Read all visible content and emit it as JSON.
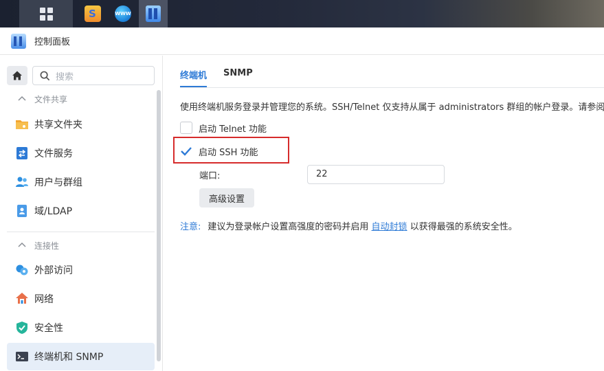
{
  "window": {
    "title": "控制面板"
  },
  "taskbar": {
    "apps": [
      {
        "name": "main-menu",
        "icon": "grid-icon"
      },
      {
        "name": "package-center",
        "icon": "package-icon"
      },
      {
        "name": "web-station",
        "icon": "www-icon",
        "badge": "WWW"
      },
      {
        "name": "control-panel",
        "icon": "control-panel-icon"
      }
    ]
  },
  "sidebar": {
    "search_placeholder": "搜索",
    "groups": [
      {
        "label": "文件共享",
        "items": [
          "共享文件夹",
          "文件服务",
          "用户与群组",
          "域/LDAP"
        ]
      },
      {
        "label": "连接性",
        "items": [
          "外部访问",
          "网络",
          "安全性",
          "终端机和 SNMP"
        ]
      }
    ],
    "active_item": "终端机和 SNMP"
  },
  "main": {
    "tabs": [
      {
        "label": "终端机",
        "active": true
      },
      {
        "label": "SNMP",
        "active": false
      }
    ],
    "description": "使用终端机服务登录并管理您的系统。SSH/Telnet 仅支持从属于 administrators 群组的帐户登录。请参阅",
    "telnet": {
      "label": "启动 Telnet 功能",
      "checked": false
    },
    "ssh": {
      "label": "启动 SSH 功能",
      "checked": true
    },
    "port": {
      "label": "端口:",
      "value": "22"
    },
    "advanced_button": "高级设置",
    "note": {
      "label": "注意:",
      "text_before": "建议为登录帐户设置高强度的密码并启用",
      "link": "自动封锁",
      "text_after": "以获得最强的系统安全性。"
    }
  },
  "colors": {
    "accent": "#2d7ad6",
    "highlight": "#d62b2b",
    "active_bg": "#e6eef8"
  }
}
